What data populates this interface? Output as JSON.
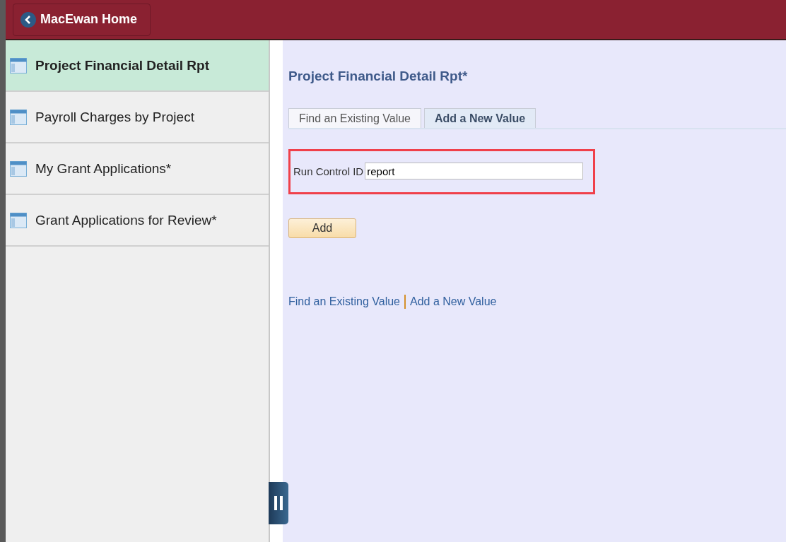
{
  "header": {
    "home_button": "MacEwan Home"
  },
  "sidebar": {
    "items": [
      {
        "label": "Project Financial Detail Rpt",
        "selected": true
      },
      {
        "label": "Payroll Charges by Project",
        "selected": false
      },
      {
        "label": "My Grant Applications*",
        "selected": false
      },
      {
        "label": "Grant Applications for Review*",
        "selected": false
      }
    ]
  },
  "page": {
    "title": "Project Financial Detail Rpt*",
    "tabs": [
      {
        "label": "Find an Existing Value",
        "selected": false
      },
      {
        "label": "Add a New Value",
        "selected": true
      }
    ],
    "field": {
      "label": "Run Control ID",
      "value": "report",
      "highlighted": true
    },
    "add_button": "Add",
    "links": [
      "Find an Existing Value",
      "Add a New Value"
    ]
  }
}
